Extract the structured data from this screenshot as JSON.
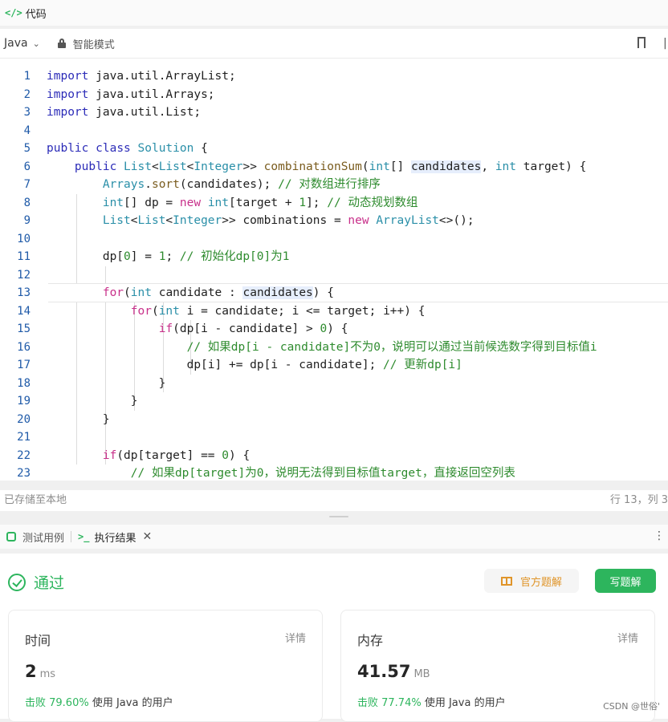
{
  "header": {
    "title": "代码",
    "icon": "code-icon"
  },
  "toolbar": {
    "language": "Java",
    "mode": "智能模式"
  },
  "editor": {
    "active_line": 13,
    "lines": [
      {
        "n": "1"
      },
      {
        "n": "2"
      },
      {
        "n": "3"
      },
      {
        "n": "4"
      },
      {
        "n": "5"
      },
      {
        "n": "6"
      },
      {
        "n": "7"
      },
      {
        "n": "8"
      },
      {
        "n": "9"
      },
      {
        "n": "10"
      },
      {
        "n": "11"
      },
      {
        "n": "12"
      },
      {
        "n": "13"
      },
      {
        "n": "14"
      },
      {
        "n": "15"
      },
      {
        "n": "16"
      },
      {
        "n": "17"
      },
      {
        "n": "18"
      },
      {
        "n": "19"
      },
      {
        "n": "20"
      },
      {
        "n": "21"
      },
      {
        "n": "22"
      },
      {
        "n": "23"
      }
    ],
    "code": [
      [
        [
          "kw",
          "import"
        ],
        [
          "",
          "java.util.ArrayList;"
        ]
      ],
      [
        [
          "kw",
          "import"
        ],
        [
          "",
          "java.util.Arrays;"
        ]
      ],
      [
        [
          "kw",
          "import"
        ],
        [
          "",
          "java.util.List;"
        ]
      ],
      [],
      [
        [
          "kw",
          "public"
        ],
        [
          "kw",
          "class"
        ],
        [
          "ty",
          "Solution"
        ],
        [
          "",
          "{"
        ]
      ],
      [
        [
          "",
          "    "
        ],
        [
          "kw",
          "public"
        ],
        [
          "ty",
          "List"
        ],
        [
          "",
          "<"
        ],
        [
          "ty",
          "List"
        ],
        [
          "",
          "<"
        ],
        [
          "ty",
          "Integer"
        ],
        [
          "",
          ">>"
        ],
        [
          "fn",
          "combinationSum"
        ],
        [
          "",
          "("
        ],
        [
          "ty",
          "int"
        ],
        [
          "",
          "[]"
        ],
        [
          "hl",
          "candidates"
        ],
        [
          ",",
          ", "
        ],
        [
          "ty",
          "int"
        ],
        [
          "",
          "target) {"
        ]
      ],
      [
        [
          "",
          "        "
        ],
        [
          "ty",
          "Arrays"
        ],
        [
          "",
          "."
        ],
        [
          "fn",
          "sort"
        ],
        [
          "",
          "(candidates);"
        ],
        [
          "cm",
          "// 对数组进行排序"
        ]
      ],
      [
        [
          "",
          "        "
        ],
        [
          "ty",
          "int"
        ],
        [
          "",
          "[] dp ="
        ],
        [
          "kw2",
          "new"
        ],
        [
          "ty",
          "int"
        ],
        [
          "",
          "[target +"
        ],
        [
          "nm",
          "1"
        ],
        [
          "",
          "];"
        ],
        [
          "cm",
          "// 动态规划数组"
        ]
      ],
      [
        [
          "",
          "        "
        ],
        [
          "ty",
          "List"
        ],
        [
          "",
          "<"
        ],
        [
          "ty",
          "List"
        ],
        [
          "",
          "<"
        ],
        [
          "ty",
          "Integer"
        ],
        [
          "",
          ">> combinations ="
        ],
        [
          "kw2",
          "new"
        ],
        [
          "ty",
          "ArrayList"
        ],
        [
          "",
          "<>();"
        ]
      ],
      [],
      [
        [
          "",
          "        dp["
        ],
        [
          "nm",
          "0"
        ],
        [
          "",
          "] ="
        ],
        [
          "nm",
          "1"
        ],
        [
          "",
          ";"
        ],
        [
          "cm",
          "// 初始化dp[0]为1"
        ]
      ],
      [],
      [
        [
          "",
          "        "
        ],
        [
          "kw2",
          "for"
        ],
        [
          "",
          "("
        ],
        [
          "ty",
          "int"
        ],
        [
          "",
          "candidate :"
        ],
        [
          "hl",
          "candidates"
        ],
        [
          "",
          ") {"
        ]
      ],
      [
        [
          "",
          "            "
        ],
        [
          "kw2",
          "for"
        ],
        [
          "",
          "("
        ],
        [
          "ty",
          "int"
        ],
        [
          "",
          "i = candidate; i <= target; i++) {"
        ]
      ],
      [
        [
          "",
          "                "
        ],
        [
          "kw2",
          "if"
        ],
        [
          "",
          "(dp[i - candidate] >"
        ],
        [
          "nm",
          "0"
        ],
        [
          "",
          ") {"
        ]
      ],
      [
        [
          "",
          "                    "
        ],
        [
          "cm",
          "// 如果dp[i - candidate]不为0，说明可以通过当前候选数字得到目标值i"
        ]
      ],
      [
        [
          "",
          "                    dp[i] += dp[i - candidate];"
        ],
        [
          "cm",
          "// 更新dp[i]"
        ]
      ],
      [
        [
          "",
          "                }"
        ]
      ],
      [
        [
          "",
          "            }"
        ]
      ],
      [
        [
          "",
          "        }"
        ]
      ],
      [],
      [
        [
          "",
          "        "
        ],
        [
          "kw2",
          "if"
        ],
        [
          "",
          "(dp[target] =="
        ],
        [
          "nm",
          "0"
        ],
        [
          "",
          ") {"
        ]
      ],
      [
        [
          "",
          "            "
        ],
        [
          "cm",
          "// 如果dp[target]为0，说明无法得到目标值target，直接返回空列表"
        ]
      ]
    ]
  },
  "status": {
    "saved": "已存储至本地",
    "cursor": "行 13，列 3"
  },
  "result_tabs": {
    "test": "测试用例",
    "result": "执行结果"
  },
  "result": {
    "status": "通过",
    "official_button": "官方题解",
    "write_button": "写题解",
    "time": {
      "label": "时间",
      "detail": "详情",
      "value": "2",
      "unit": "ms",
      "beat_pct": "击败 79.60%",
      "beat_rest": "使用 Java 的用户"
    },
    "memory": {
      "label": "内存",
      "detail": "详情",
      "value": "41.57",
      "unit": "MB",
      "beat_pct": "击败 77.74%",
      "beat_rest": "使用 Java 的用户"
    }
  },
  "watermark": "CSDN @世俗'",
  "colors": {
    "accent_green": "#2db55d",
    "accent_orange": "#e0952a"
  }
}
